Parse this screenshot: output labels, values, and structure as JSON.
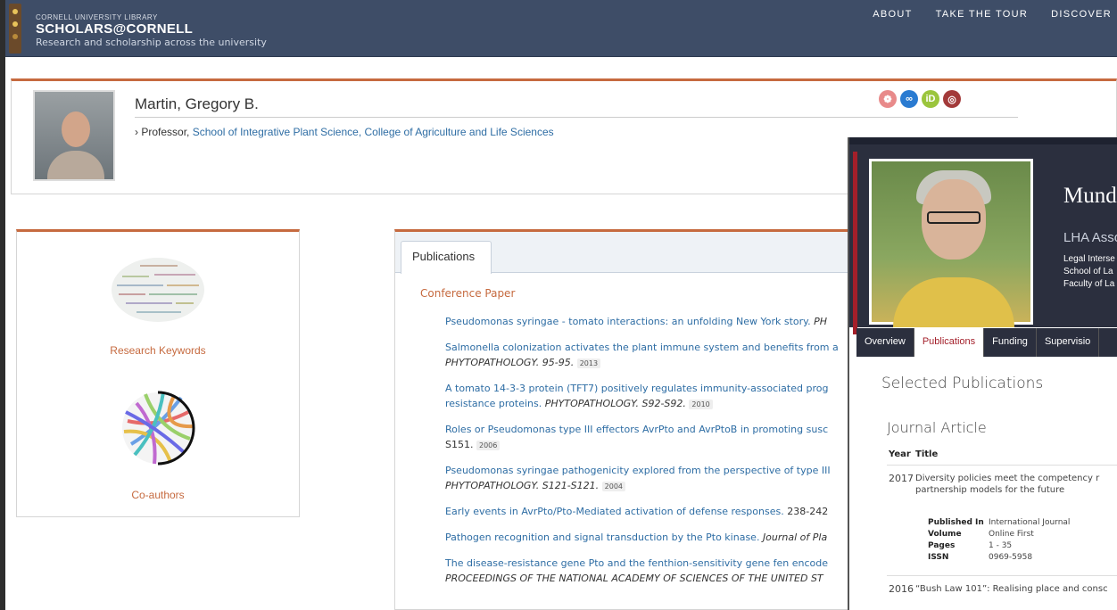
{
  "header": {
    "small": "CORNELL UNIVERSITY LIBRARY",
    "brand": "SCHOLARS@CORNELL",
    "tagline": "Research and scholarship across the university",
    "nav": [
      "ABOUT",
      "TAKE THE TOUR",
      "DISCOVER"
    ]
  },
  "profile": {
    "name": "Martin, Gregory B.",
    "title_prefix": "Professor,",
    "title_links": "School of Integrative Plant Science, College of Agriculture and Life Sciences",
    "icons": [
      "cornell-seal-icon",
      "link-icon",
      "orcid-icon",
      "globe-icon"
    ]
  },
  "left_panel": {
    "keywords_label": "Research Keywords",
    "coauthors_label": "Co-authors"
  },
  "publications": {
    "tab": "Publications",
    "heading": "Conference Paper",
    "items": [
      {
        "title": "Pseudomonas syringae - tomato interactions: an unfolding New York story.",
        "journal": "PH",
        "year": ""
      },
      {
        "title": "Salmonella colonization activates the plant immune system and benefits from a",
        "line2": "PHYTOPATHOLOGY. 95-95.",
        "year": "2013"
      },
      {
        "title": "A tomato 14-3-3 protein (TFT7) positively regulates immunity-associated prog",
        "line2_link": "resistance proteins.",
        "line2": "PHYTOPATHOLOGY. S92-S92.",
        "year": "2010"
      },
      {
        "title": "Roles or Pseudomonas type III effectors AvrPto and AvrPtoB in promoting susc",
        "line2": "S151.",
        "year": "2006"
      },
      {
        "title": "Pseudomonas syringae pathogenicity explored from the perspective of type III",
        "line2": "PHYTOPATHOLOGY. S121-S121.",
        "year": "2004"
      },
      {
        "title": "Early events in AvrPto/Pto-Mediated activation of defense responses.",
        "journal": "238-242",
        "year": ""
      },
      {
        "title": "Pathogen recognition and signal transduction by the Pto kinase.",
        "journal": "Journal of Pla",
        "year": ""
      },
      {
        "title": "The disease-resistance gene Pto and the fenthion-sensitivity gene fen encode",
        "line2": "PROCEEDINGS OF THE NATIONAL ACADEMY OF SCIENCES OF THE UNITED ST",
        "year": ""
      }
    ]
  },
  "overlay": {
    "name": "Mund",
    "role": "LHA Asso",
    "org": [
      "Legal Interse",
      "School of La",
      "Faculty of La"
    ],
    "tabs": [
      "Overview",
      "Publications",
      "Funding",
      "Supervisio"
    ],
    "active_tab": "Publications",
    "section": "Selected Publications",
    "subsection": "Journal Article",
    "col_year": "Year",
    "col_title": "Title",
    "articles": [
      {
        "year": "2017",
        "title": "Diversity policies meet the competency r partnership models for the future",
        "meta": [
          {
            "k": "Published In",
            "v": "International Journal"
          },
          {
            "k": "Volume",
            "v": "Online First"
          },
          {
            "k": "Pages",
            "v": "1 - 35"
          },
          {
            "k": "ISSN",
            "v": "0969-5958"
          }
        ]
      },
      {
        "year": "2016",
        "title": "“Bush Law 101”: Realising place and consc"
      }
    ]
  },
  "colors": {
    "header_bg": "#3e4d67",
    "accent": "#c66a3f",
    "link": "#2e6da4",
    "overlay_dark": "#2b2f3e",
    "overlay_red": "#a31f2a"
  }
}
